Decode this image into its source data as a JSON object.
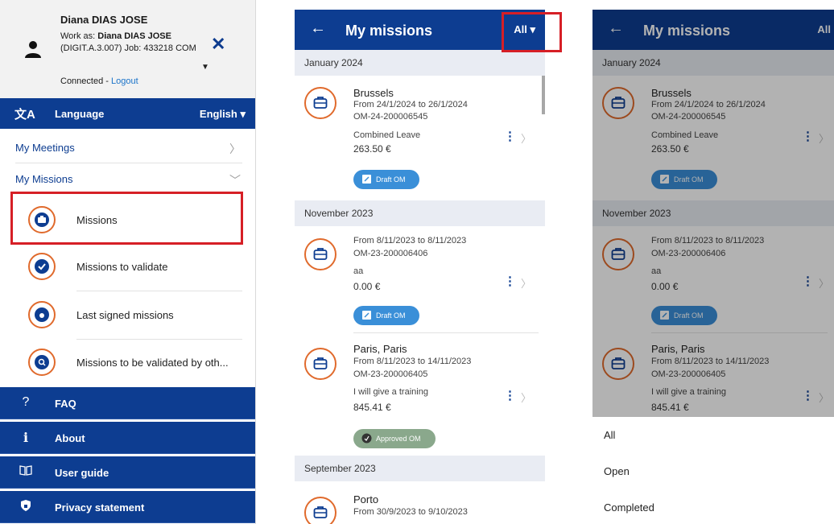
{
  "menu": {
    "user_name": "Diana DIAS JOSE",
    "work_as_prefix": "Work as: ",
    "work_as_name": "Diana DIAS JOSE",
    "work_details": "(DIGIT.A.3.007) Job: 433218 COM",
    "connected": "Connected - ",
    "logout": "Logout",
    "language_label": "Language",
    "language_value": "English",
    "my_meetings": "My Meetings",
    "my_missions": "My Missions",
    "sub_items": [
      {
        "label": "Missions",
        "icon": "briefcase-icon"
      },
      {
        "label": "Missions to validate",
        "icon": "validate-bag-icon"
      },
      {
        "label": "Last signed missions",
        "icon": "signed-icon"
      },
      {
        "label": "Missions to be validated by oth...",
        "icon": "search-icon"
      }
    ],
    "nav": [
      {
        "label": "FAQ",
        "icon": "?"
      },
      {
        "label": "About",
        "icon": "i"
      },
      {
        "label": "User guide",
        "icon": "book-icon"
      },
      {
        "label": "Privacy statement",
        "icon": "shield-icon"
      }
    ]
  },
  "list": {
    "title": "My missions",
    "filter": "All",
    "months": [
      "January 2024",
      "November 2023",
      "September 2023"
    ],
    "missions": [
      {
        "city": "Brussels",
        "dates": "From 24/1/2024 to 26/1/2024",
        "ref": "OM-24-200006545",
        "desc": "Combined Leave",
        "amount": "263.50 €",
        "status": "Draft OM"
      },
      {
        "city": "",
        "dates": "From 8/11/2023 to 8/11/2023",
        "ref": "OM-23-200006406",
        "desc": "aa",
        "amount": "0.00 €",
        "status": "Draft OM"
      },
      {
        "city": "Paris, Paris",
        "dates": "From 8/11/2023 to 14/11/2023",
        "ref": "OM-23-200006405",
        "desc": "I will give a training",
        "amount": "845.41 €",
        "status": "Approved OM"
      },
      {
        "city": "Porto",
        "dates": "From 30/9/2023 to 9/10/2023"
      }
    ],
    "filter_options": [
      "All",
      "Open",
      "Completed"
    ]
  },
  "colors": {
    "brand_blue": "#0d3d91",
    "accent_orange": "#e06a2c",
    "highlight_red": "#d61f26"
  }
}
